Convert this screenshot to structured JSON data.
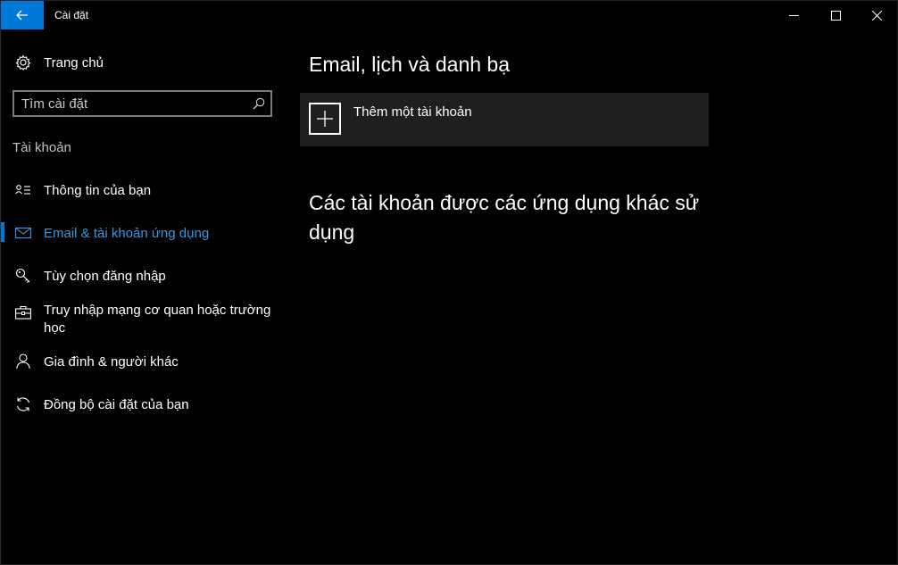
{
  "titlebar": {
    "title": "Cài đặt",
    "back_icon": "arrow-left-icon",
    "accent": "#0078d7"
  },
  "sidebar": {
    "home_label": "Trang chủ",
    "search_placeholder": "Tìm cài đặt",
    "section_label": "Tài khoản",
    "items": [
      {
        "label": "Thông tin của bạn",
        "icon": "person-card-icon",
        "active": false
      },
      {
        "label": "Email & tài khoản ứng dụng",
        "icon": "mail-icon",
        "active": true
      },
      {
        "label": "Tùy chọn đăng nhập",
        "icon": "key-icon",
        "active": false
      },
      {
        "label": "Truy nhập mạng cơ quan hoặc trường học",
        "icon": "briefcase-icon",
        "active": false
      },
      {
        "label": "Gia đình & người khác",
        "icon": "person-icon",
        "active": false
      },
      {
        "label": "Đồng bộ cài đặt của bạn",
        "icon": "sync-icon",
        "active": false
      }
    ]
  },
  "main": {
    "title": "Email, lịch và danh bạ",
    "add_account_label": "Thêm một tài khoản",
    "other_apps_title": "Các tài khoản được các ứng dụng khác sử dụng"
  },
  "colors": {
    "active_text": "#3a96dd",
    "card_bg": "#1f1f1f"
  }
}
